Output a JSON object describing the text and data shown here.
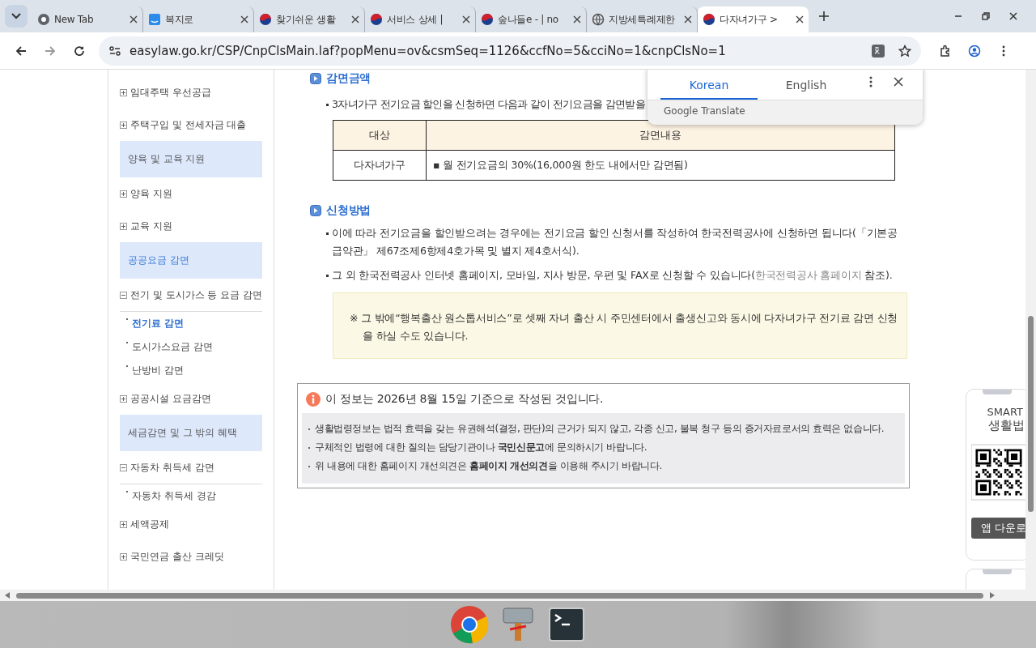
{
  "browser": {
    "tabs": [
      {
        "title": "New Tab",
        "selected": false
      },
      {
        "title": "복지로",
        "selected": false
      },
      {
        "title": "찾기쉬운 생활",
        "selected": false
      },
      {
        "title": "서비스 상세 | ",
        "selected": false
      },
      {
        "title": "숲나들e - | no",
        "selected": false
      },
      {
        "title": "지방세특례제한",
        "selected": false
      },
      {
        "title": "다자녀가구 >",
        "selected": true
      }
    ],
    "url": "easylaw.go.kr/CSP/CnpClsMain.laf?popMenu=ov&csmSeq=1126&ccfNo=5&cciNo=1&cnpClsNo=1"
  },
  "sidebar": {
    "items": [
      {
        "kind": "item",
        "label": "임대주택 우선공급",
        "expanded": false
      },
      {
        "kind": "item",
        "label": "주택구입 및 전세자금 대출",
        "expanded": false
      },
      {
        "kind": "header",
        "label": "양육 및 교육 지원",
        "selected": false
      },
      {
        "kind": "item",
        "label": "양육 지원",
        "expanded": false
      },
      {
        "kind": "item",
        "label": "교육 지원",
        "expanded": false
      },
      {
        "kind": "header",
        "label": "공공요금 감면",
        "selected": true
      },
      {
        "kind": "item",
        "label": "전기 및 도시가스 등 요금 감면",
        "expanded": true
      },
      {
        "kind": "sub",
        "label": "전기료 감면",
        "selected": true
      },
      {
        "kind": "sub",
        "label": "도시가스요금 감면",
        "selected": false
      },
      {
        "kind": "sub",
        "label": "난방비 감면",
        "selected": false
      },
      {
        "kind": "item",
        "label": "공공시설 요금감면",
        "expanded": false
      },
      {
        "kind": "header",
        "label": "세금감면 및 그 밖의 혜택",
        "selected": false
      },
      {
        "kind": "item",
        "label": "자동차 취득세 감면",
        "expanded": true
      },
      {
        "kind": "sub",
        "label": "자동차 취득세 경감",
        "selected": false
      },
      {
        "kind": "item",
        "label": "세액공제",
        "expanded": false
      },
      {
        "kind": "item",
        "label": "국민연금 출산 크레딧",
        "expanded": false
      }
    ]
  },
  "content": {
    "section_1": {
      "heading": "감면금액",
      "bullet": "3자녀가구 전기요금 할인을 신청하면 다음과 같이 전기요금을 감면받을",
      "table": {
        "columns": [
          "대상",
          "감면내용"
        ],
        "rows": [
          [
            "다자녀가구",
            "▪ 월 전기요금의 30%(16,000원 한도 내에서만 감면됨)"
          ]
        ]
      }
    },
    "section_2": {
      "heading": "신청방법",
      "bullets": [
        {
          "text": "이에 따라 전기요금을 할인받으려는 경우에는 전기요금 할인 신청서를 작성하여 한국전력공사에 신청하면 됩니다(「기본공급약관」 제67조제6항제4호가목 및 별지 제4호서식)."
        },
        {
          "text": "그 외 한국전력공사 인터넷 홈페이지, 모바일, 지사 방문, 우편 및 FAX로 신청할 수 있습니다(",
          "link": "한국전력공사 홈페이지",
          "after": " 참조)."
        }
      ],
      "note": "※ 그 밖에“행복출산 원스톱서비스”로 셋째 자녀 출산 시 주민센터에서 출생신고와 동시에 다자녀가구 전기료 감면 신청을 하실 수도 있습니다."
    },
    "info": {
      "title": "이 정보는 2026년 8월 15일 기준으로 작성된 것입니다.",
      "lines": [
        "생활법령정보는 법적 효력을 갖는 유권해석(결정, 판단)의 근거가 되지 않고, 각종 신고, 불복 청구 등의 증거자료로서의 효력은 없습니다.",
        "구체적인 법령에 대한 질의는 담당기관이나 **국민신문고**에 문의하시기 바랍니다.",
        "위 내용에 대한 홈페이지 개선의견은 **홈페이지 개선의견**을 이용해 주시기 바랍니다."
      ]
    }
  },
  "app_banner": {
    "title": "SMART",
    "subtitle": "생활법",
    "button": "앱 다운로"
  },
  "translate_popup": {
    "tabs": [
      {
        "label": "Korean",
        "selected": true
      },
      {
        "label": "English",
        "selected": false
      }
    ],
    "brand": "Google Translate"
  }
}
